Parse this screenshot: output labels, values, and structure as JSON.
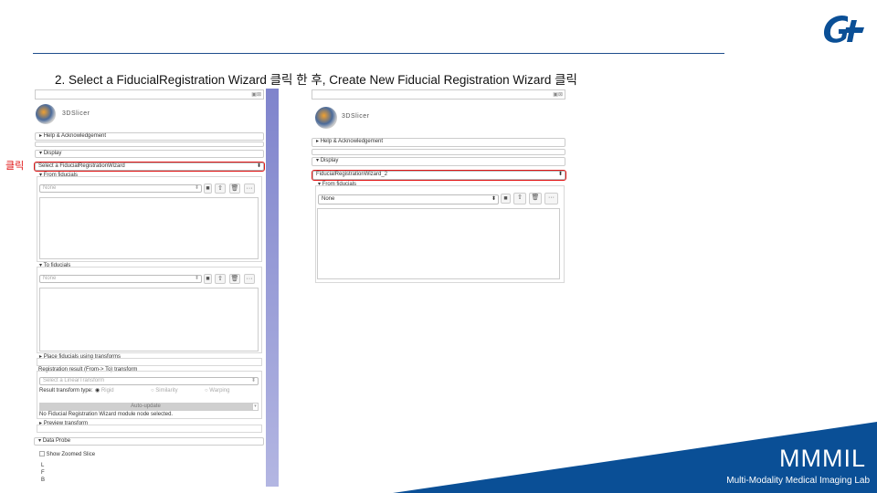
{
  "slide": {
    "title": "2. Select a FiducialRegistration Wizard 클릭 한 후, Create New Fiducial Registration Wizard 클릭",
    "click_label": "클릭",
    "lab_name": "MMMIL",
    "lab_full": "Multi-Modality Medical Imaging Lab",
    "colors": {
      "brand": "#0a4f96",
      "highlight": "#e01515"
    }
  },
  "left_panel": {
    "app": "3DSlicer",
    "help": "Help & Acknowledgement",
    "display": "Display",
    "selector": "Select a FiducialRegistrationWizard",
    "from_fiducials": "From fiducials",
    "from_value": "None",
    "to_fiducials": "To fiducials",
    "to_value": "None",
    "place_fiducials": "Place fiducials using transforms",
    "registration_result": "Registration result (From-> To) transform",
    "transform_placeholder": "Select a LinearTransform",
    "result_type_label": "Result transform type:",
    "rigid": "Rigid",
    "similarity": "Similarity",
    "warping": "Warping",
    "auto_update": "Auto-update",
    "status": "No Fiducial Registration Wizard module node selected.",
    "preview": "Preview transform",
    "data_probe": "Data Probe",
    "show_zoomed": "Show Zoomed Slice",
    "coords": [
      "L",
      "F",
      "B"
    ]
  },
  "right_panel": {
    "app": "3DSlicer",
    "help": "Help & Acknowledgement",
    "display": "Display",
    "selector": "FiducialRegistrationWizard_2",
    "from_fiducials": "From fiducials",
    "from_value": "None"
  }
}
